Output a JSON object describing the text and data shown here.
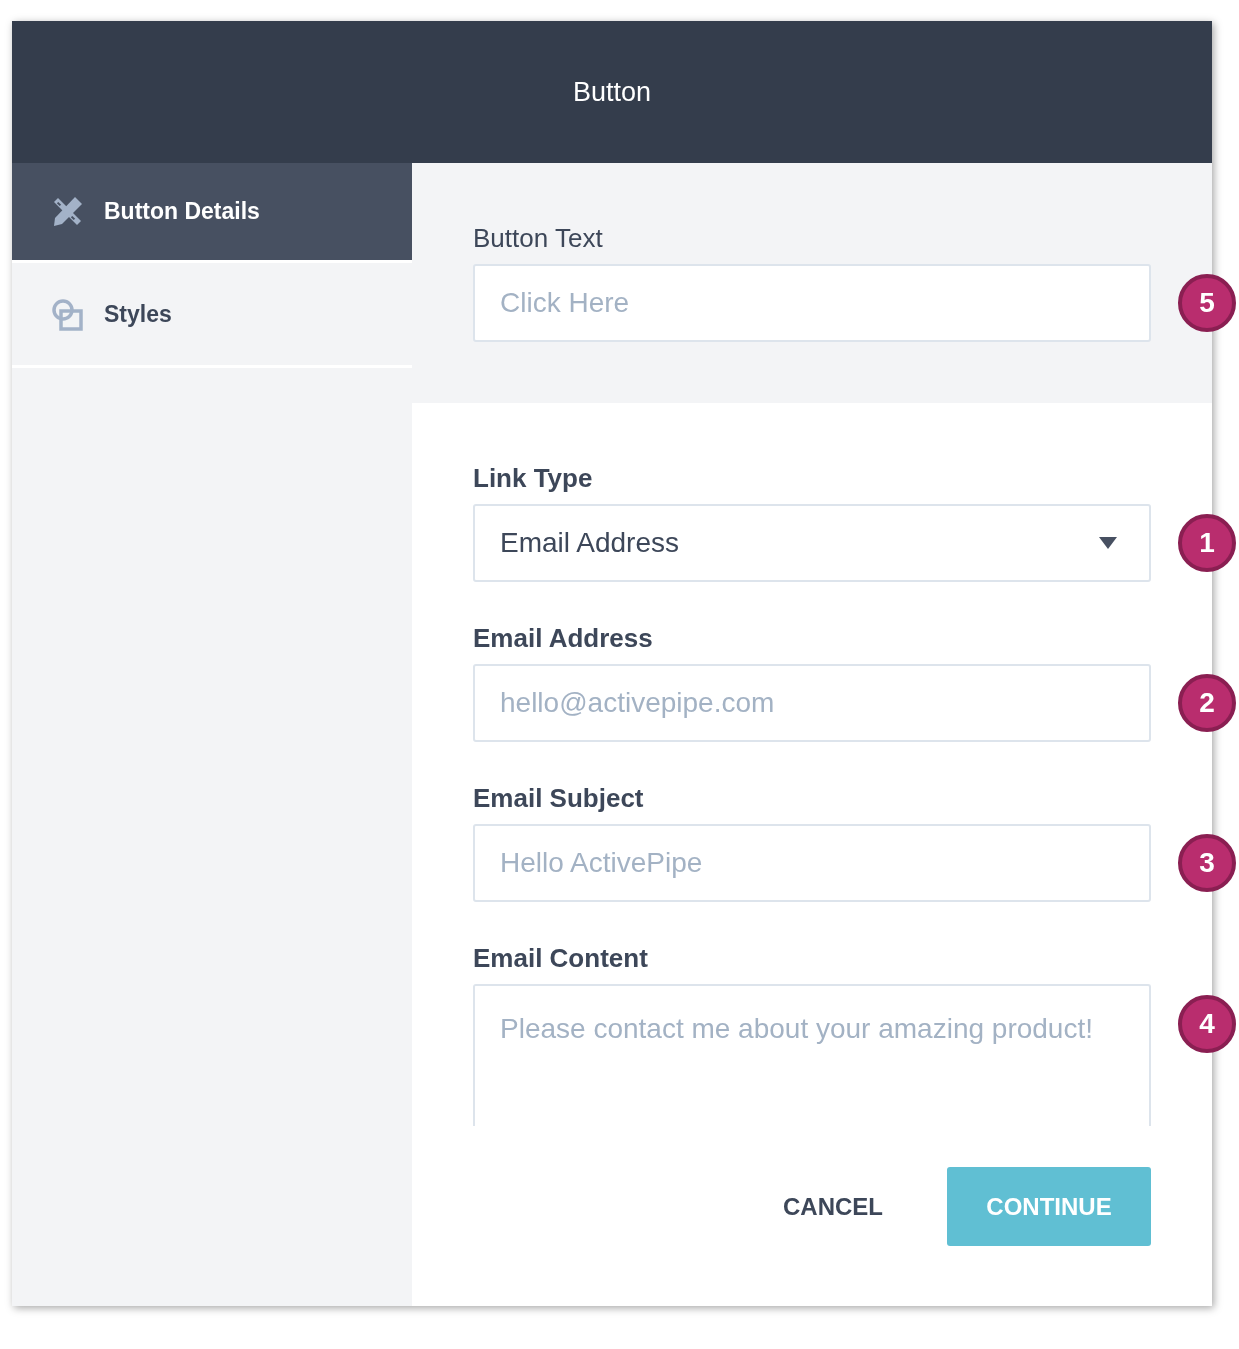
{
  "dialog": {
    "title": "Button"
  },
  "sidebar": {
    "items": [
      {
        "label": "Button Details",
        "selected": true
      },
      {
        "label": "Styles",
        "selected": false
      }
    ]
  },
  "button_text": {
    "label": "Button Text",
    "placeholder": "Click Here",
    "badge": "5"
  },
  "fields": [
    {
      "kind": "select",
      "label": "Link Type",
      "value": "Email Address",
      "badge": "1"
    },
    {
      "kind": "input",
      "label": "Email Address",
      "placeholder": "hello@activepipe.com",
      "badge": "2"
    },
    {
      "kind": "input",
      "label": "Email Subject",
      "placeholder": "Hello ActivePipe",
      "badge": "3"
    },
    {
      "kind": "textarea",
      "label": "Email Content",
      "placeholder": "Please contact me about your amazing product!",
      "badge": "4"
    }
  ],
  "buttons": {
    "cancel": "CANCEL",
    "continue": "CONTINUE"
  }
}
